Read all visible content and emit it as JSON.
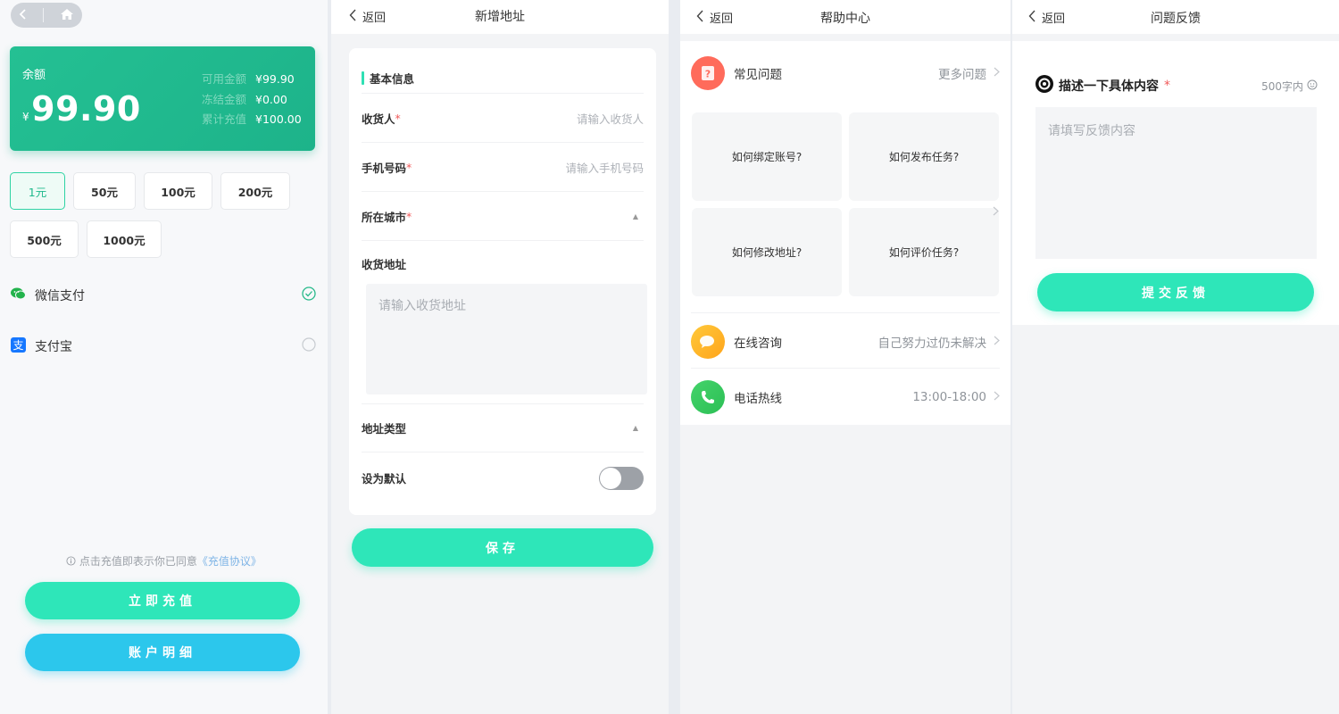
{
  "recharge": {
    "balance_label": "余额",
    "currency_symbol": "¥",
    "balance": "99.90",
    "stats": [
      {
        "label": "可用金额",
        "value": "¥99.90"
      },
      {
        "label": "冻结金额",
        "value": "¥0.00"
      },
      {
        "label": "累计充值",
        "value": "¥100.00"
      }
    ],
    "amounts": [
      "1元",
      "50元",
      "100元",
      "200元",
      "500元",
      "1000元"
    ],
    "selected_amount": "1元",
    "payments": [
      {
        "label": "微信支付",
        "icon": "wechat-icon",
        "selected": true
      },
      {
        "label": "支付宝",
        "icon": "alipay-icon",
        "selected": false
      }
    ],
    "agreement_text": "点击充值即表示你已同意",
    "agreement_link": "《充值协议》",
    "recharge_button": "立即充值",
    "detail_button": "账户明细",
    "colors": {
      "accent": "#24c093",
      "button_green": "#2ee6b9",
      "button_blue": "#2cc7ec"
    }
  },
  "address": {
    "back": "返回",
    "title": "新增地址",
    "section_title": "基本信息",
    "fields": {
      "receiver_label": "收货人",
      "receiver_placeholder": "请输入收货人",
      "phone_label": "手机号码",
      "phone_placeholder": "请输入手机号码",
      "city_label": "所在城市",
      "address_label": "收货地址",
      "address_placeholder": "请输入收货地址",
      "type_label": "地址类型",
      "default_label": "设为默认"
    },
    "required_mark": "*",
    "default_on": false,
    "save_button": "保存"
  },
  "help": {
    "back": "返回",
    "title": "帮助中心",
    "faq_label": "常见问题",
    "faq_more": "更多问题",
    "questions": [
      "如何绑定账号?",
      "如何发布任务?",
      "如何修改地址?",
      "如何评价任务?"
    ],
    "online_label": "在线咨询",
    "online_right": "自己努力过仍未解决",
    "phone_label": "电话热线",
    "phone_right": "13:00-18:00"
  },
  "feedback": {
    "back": "返回",
    "title": "问题反馈",
    "describe_label": "描述一下具体内容",
    "required_mark": "*",
    "limit": "500字内",
    "placeholder": "请填写反馈内容",
    "submit_button": "提交反馈"
  }
}
